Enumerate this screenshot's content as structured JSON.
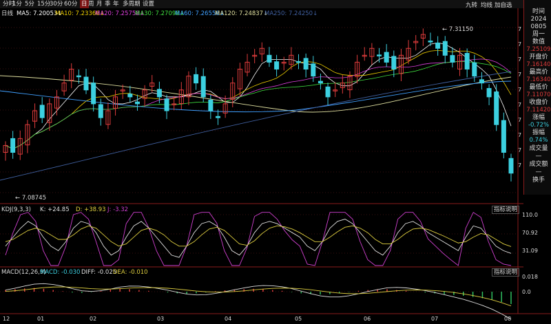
{
  "toolbar": {
    "items": [
      "分时",
      "1分",
      "5分",
      "15分",
      "30分",
      "60分",
      "日",
      "周",
      "月",
      "季",
      "年",
      "多周期",
      "设置"
    ],
    "active_index": 6,
    "right_items": [
      "九转",
      "均线",
      "加自选"
    ]
  },
  "main_panel": {
    "period_label": "日线",
    "ma_legend": [
      {
        "label": "MA5: 7.20053",
        "color": "#ffffff"
      },
      {
        "label": "MA10: 7.23366",
        "color": "#f0d000"
      },
      {
        "label": "MA20: 7.25758",
        "color": "#e040e0"
      },
      {
        "label": "MA30: 7.27098",
        "color": "#40e040"
      },
      {
        "label": "MA60: 7.26556",
        "color": "#40a0ff"
      },
      {
        "label": "MA120: 7.24837",
        "color": "#e0e0a0"
      },
      {
        "label": "MA250: 7.24250",
        "color": "#4060a0"
      }
    ],
    "high_label": "7.31150",
    "low_label": "7.08745",
    "price_axis": [
      "7",
      "7",
      "7",
      "7",
      "7",
      "7",
      "7",
      "7",
      "7",
      "7"
    ]
  },
  "sidebar": {
    "time_label": "时间",
    "year": "2024",
    "date": "0805",
    "weekday": "周一",
    "value_label": "数值",
    "value": "7.25109",
    "open_label": "开盘价",
    "open": "7.16140",
    "high_label": "最高价",
    "high": "7.16340",
    "low_label": "最低价",
    "low": "7.11070",
    "close_label": "收盘价",
    "close": "7.11420",
    "change_label": "涨幅",
    "change": "-0.72%",
    "amplitude_label": "振幅",
    "amplitude": "0.74%",
    "volume_label": "成交量",
    "volume": "—",
    "turnover_label": "成交额",
    "turnover": "—",
    "turnover_rate_label": "换手"
  },
  "kdj": {
    "title": "KDJ(9,3,3)",
    "k": "K: +24.85",
    "d": "D: +38.93",
    "j": "J: -3.32",
    "explain": "指标说明",
    "axis": [
      "110.0",
      "70.92",
      "31.09"
    ]
  },
  "macd": {
    "title": "MACD(12,26,9)",
    "macd": "MACD: -0.030",
    "diff": "DIFF: -0.025",
    "dea": "DEA: -0.010",
    "explain": "指标说明",
    "axis": [
      "0.018",
      "0.0"
    ]
  },
  "time_axis": [
    "12",
    "01",
    "02",
    "03",
    "04",
    "05",
    "06",
    "07",
    "08"
  ],
  "colors": {
    "up": "#e03c3c",
    "down": "#3cd0e0",
    "k": "#e0e0e0",
    "d": "#e0d040",
    "j": "#d040d0"
  },
  "chart_data": {
    "type": "candlestick",
    "series_close": [
      7.15,
      7.14,
      7.16,
      7.18,
      7.2,
      7.19,
      7.21,
      7.22,
      7.24,
      7.26,
      7.25,
      7.23,
      7.21,
      7.19,
      7.2,
      7.22,
      7.23,
      7.22,
      7.21,
      7.23,
      7.24,
      7.22,
      7.2,
      7.21,
      7.23,
      7.25,
      7.24,
      7.22,
      7.2,
      7.19,
      7.21,
      7.24,
      7.26,
      7.27,
      7.28,
      7.29,
      7.27,
      7.26,
      7.27,
      7.28,
      7.27,
      7.26,
      7.25,
      7.24,
      7.22,
      7.23,
      7.24,
      7.25,
      7.27,
      7.28,
      7.29,
      7.28,
      7.27,
      7.26,
      7.28,
      7.29,
      7.3,
      7.31,
      7.3,
      7.29,
      7.28,
      7.27,
      7.28,
      7.26,
      7.25,
      7.24,
      7.22,
      7.18,
      7.14,
      7.11
    ],
    "kdj_k": [
      40,
      60,
      80,
      95,
      85,
      60,
      40,
      30,
      50,
      80,
      95,
      90,
      70,
      40,
      20,
      30,
      60,
      85,
      95,
      80,
      60,
      40,
      20,
      15,
      40,
      70,
      90,
      95,
      85,
      60,
      30,
      20,
      40,
      70,
      90,
      95,
      90,
      80,
      70,
      60,
      40,
      30,
      50,
      80,
      95,
      100,
      90,
      70,
      50,
      30,
      20,
      40,
      70,
      90,
      95,
      85,
      70,
      60,
      50,
      40,
      30,
      60,
      85,
      80,
      60,
      40,
      30,
      24
    ],
    "kdj_d": [
      50,
      55,
      65,
      75,
      80,
      75,
      65,
      55,
      55,
      65,
      78,
      85,
      80,
      65,
      50,
      40,
      45,
      60,
      75,
      80,
      75,
      65,
      50,
      40,
      40,
      50,
      65,
      78,
      82,
      75,
      60,
      45,
      42,
      52,
      68,
      80,
      85,
      83,
      78,
      70,
      60,
      50,
      50,
      60,
      72,
      82,
      85,
      80,
      70,
      55,
      45,
      45,
      55,
      68,
      78,
      80,
      77,
      70,
      63,
      55,
      47,
      50,
      60,
      68,
      65,
      55,
      45,
      39
    ],
    "macd_hist": [
      0.004,
      0.006,
      0.008,
      0.009,
      0.007,
      0.004,
      0.001,
      -0.002,
      -0.003,
      -0.001,
      0.002,
      0.005,
      0.007,
      0.006,
      0.004,
      0.002,
      0.0,
      -0.002,
      -0.004,
      -0.005,
      -0.004,
      -0.002,
      0.001,
      0.003,
      0.005,
      0.006,
      0.007,
      0.006,
      0.004,
      0.002,
      -0.001,
      -0.004,
      -0.006,
      -0.007,
      -0.006,
      -0.004,
      -0.001,
      0.002,
      0.004,
      0.005,
      0.006,
      0.004,
      0.002,
      0.0,
      -0.002,
      -0.004,
      -0.006,
      -0.008,
      -0.01,
      -0.013,
      -0.016,
      -0.02,
      -0.025,
      -0.03
    ]
  }
}
